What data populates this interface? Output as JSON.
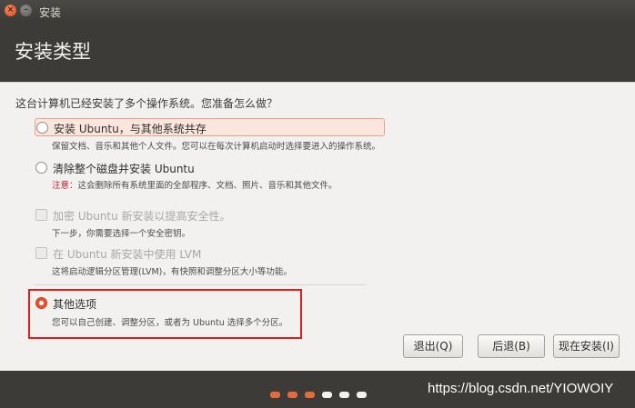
{
  "window": {
    "title": "安装"
  },
  "header": {
    "title": "安装类型"
  },
  "question": "这台计算机已经安装了多个操作系统。您准备怎么做？",
  "options": [
    {
      "label": "安装 Ubuntu，与其他系统共存",
      "desc": "保留文档、音乐和其他个人文件。您可以在每次计算机启动时选择要进入的操作系统。",
      "selected": false
    },
    {
      "label": "清除整个磁盘并安装 Ubuntu",
      "warn": "注意：",
      "desc": "这会删除所有系统里面的全部程序、文档、照片、音乐和其他文件。",
      "selected": false
    },
    {
      "label": "加密 Ubuntu 新安装以提高安全性。",
      "desc": "下一步，你需要选择一个安全密钥。",
      "disabled": true
    },
    {
      "label": "在 Ubuntu 新安装中使用 LVM",
      "desc": "这将启动逻辑分区管理(LVM)，有快照和调整分区大小等功能。",
      "disabled": true
    },
    {
      "label": "其他选项",
      "desc": "您可以自己创建、调整分区，或者为 Ubuntu 选择多个分区。",
      "selected": true
    }
  ],
  "buttons": {
    "quit": "退出(Q)",
    "back": "后退(B)",
    "install": "现在安装(I)"
  },
  "progress": {
    "total_steps": 6,
    "completed_steps": 3,
    "active_color": "#e56b3b",
    "inactive_color": "#f2f1f0"
  },
  "watermark": "https://blog.csdn.net/YIOWOIY",
  "colors": {
    "accent": "#e5552d",
    "dark_bg": "#3c3b37",
    "content_bg": "#f2f1f0",
    "annotation": "#e41b1b"
  }
}
